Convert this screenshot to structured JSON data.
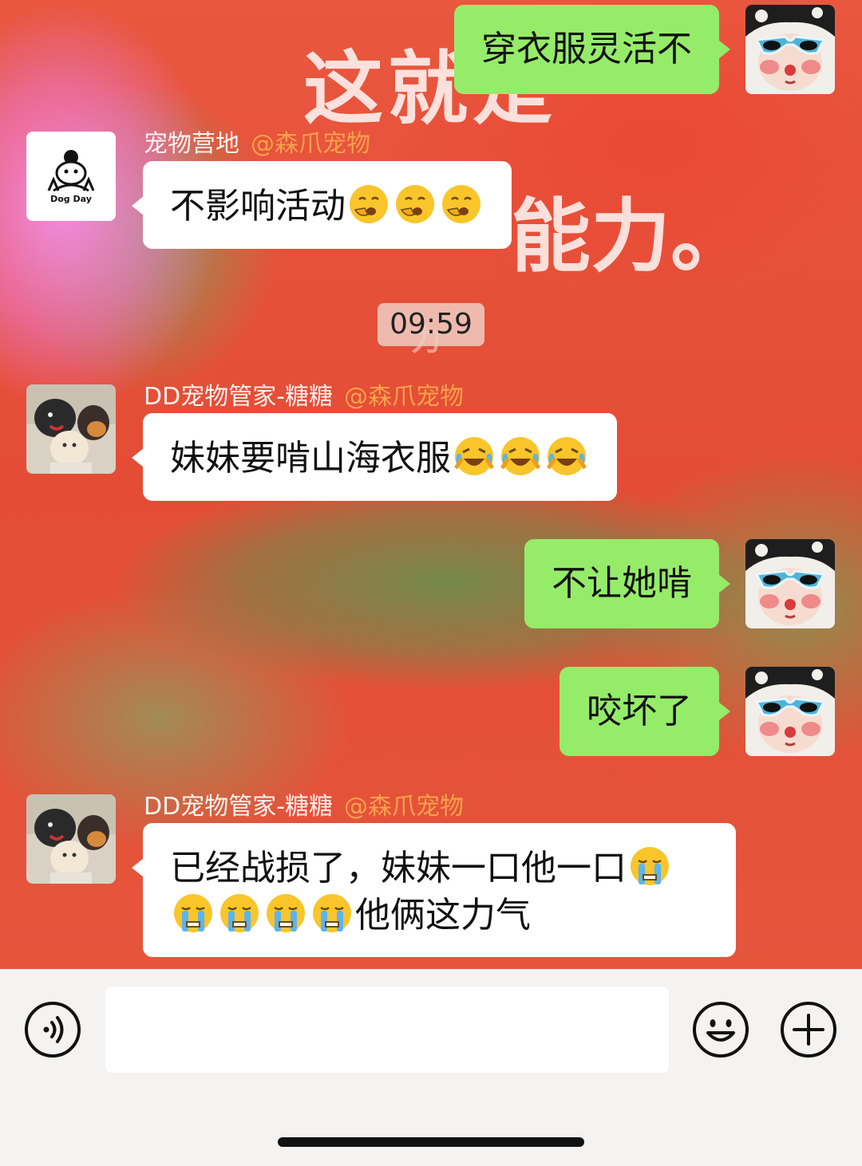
{
  "wallpaper": {
    "line1": "这就是",
    "line2": "能力。",
    "line3": "力"
  },
  "messages": [
    {
      "side": "self",
      "text": "穿衣服灵活不",
      "emojis": []
    },
    {
      "side": "other",
      "sender": "宠物营地",
      "mention": "@森爪宠物",
      "text": "不影响活动",
      "emojis": [
        "yawn-emoji",
        "yawn-emoji",
        "yawn-emoji"
      ]
    },
    {
      "type": "timestamp",
      "text": "09:59"
    },
    {
      "side": "other",
      "sender": "DD宠物管家-糖糖",
      "mention": "@森爪宠物",
      "text": "妹妹要啃山海衣服",
      "emojis": [
        "laugh-cry-emoji",
        "laugh-cry-emoji",
        "laugh-cry-emoji"
      ]
    },
    {
      "side": "self",
      "text": "不让她啃",
      "emojis": []
    },
    {
      "side": "self",
      "text": "咬坏了",
      "emojis": []
    },
    {
      "side": "other",
      "sender": "DD宠物管家-糖糖",
      "mention": "@森爪宠物",
      "text_part1": "已经战损了，妹妹一口他一口",
      "text_part2": "他俩这力气",
      "emojis": [
        "crying-emoji",
        "crying-emoji",
        "crying-emoji",
        "crying-emoji",
        "crying-emoji"
      ]
    }
  ],
  "avatars": {
    "self": "doll-with-sunglasses-avatar",
    "pet_camp": "dog-day-logo-avatar",
    "tangtang": "pets-photo-avatar"
  },
  "logo_text": "Dog Day",
  "input": {
    "placeholder": ""
  },
  "colors": {
    "self_bubble": "#95ec69",
    "other_bubble": "#ffffff",
    "mention": "#f7a24a"
  }
}
